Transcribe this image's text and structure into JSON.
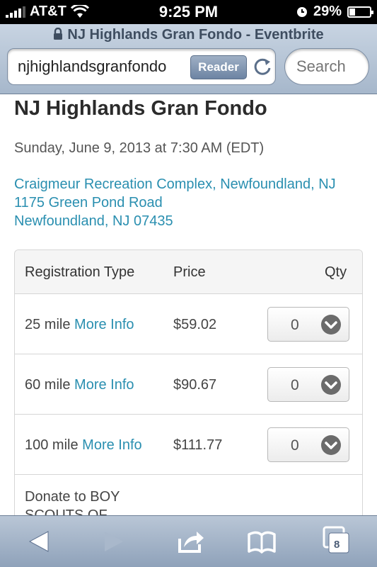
{
  "status_bar": {
    "carrier": "AT&T",
    "time": "9:25 PM",
    "battery": "29%",
    "battery_level": 0.29
  },
  "browser": {
    "page_title": "NJ Highlands Gran Fondo - Eventbrite",
    "url": "njhighlandsgranfondo",
    "reader_label": "Reader",
    "search_placeholder": "Search",
    "tab_count": "8"
  },
  "event": {
    "title": "NJ Highlands Gran Fondo",
    "date": "Sunday, June 9, 2013 at 7:30 AM (EDT)",
    "venue": "Craigmeur Recreation Complex, Newfoundland, NJ",
    "street": "1175 Green Pond Road",
    "city": "Newfoundland, NJ 07435"
  },
  "table": {
    "headers": {
      "type": "Registration Type",
      "price": "Price",
      "qty": "Qty"
    },
    "rows": [
      {
        "type": "25 mile",
        "more_info": "More Info",
        "price": "$59.02",
        "qty": "0"
      },
      {
        "type": "60 mile",
        "more_info": "More Info",
        "price": "$90.67",
        "qty": "0"
      },
      {
        "type": "100 mile",
        "more_info": "More Info",
        "price": "$111.77",
        "qty": "0"
      }
    ],
    "donate_line1": "Donate to BOY",
    "donate_line2": "SCOUTS OF"
  },
  "icons": {
    "wifi": "wifi-icon",
    "lock": "lock-icon",
    "reload": "reload-icon",
    "back": "back-arrow-icon",
    "forward": "forward-arrow-icon",
    "share": "share-icon",
    "bookmarks": "bookmarks-icon",
    "tabs": "tabs-icon"
  }
}
